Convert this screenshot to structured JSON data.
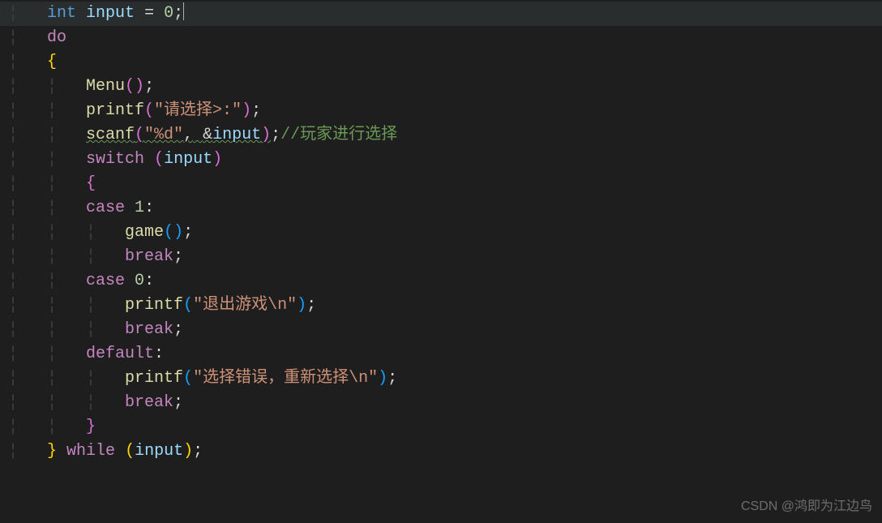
{
  "code": {
    "l1_kw_int": "int",
    "l1_var": "input",
    "l1_eq": "=",
    "l1_num": "0",
    "l1_semi": ";",
    "l2_do": "do",
    "l3_brace": "{",
    "l4_menu": "Menu",
    "l4_paren_o": "(",
    "l4_paren_c": ")",
    "l4_semi": ";",
    "l5_printf": "printf",
    "l5_paren_o": "(",
    "l5_str": "\"请选择>:\"",
    "l5_paren_c": ")",
    "l5_semi": ";",
    "l6_scanf": "scanf",
    "l6_paren_o": "(",
    "l6_str": "\"%d\"",
    "l6_comma": ",",
    "l6_amp": "&",
    "l6_var": "input",
    "l6_paren_c": ")",
    "l6_semi": ";",
    "l6_comment": "//玩家进行选择",
    "l7_switch": "switch",
    "l7_paren_o": "(",
    "l7_var": "input",
    "l7_paren_c": ")",
    "l8_brace": "{",
    "l9_case": "case",
    "l9_num": "1",
    "l9_colon": ":",
    "l10_game": "game",
    "l10_paren_o": "(",
    "l10_paren_c": ")",
    "l10_semi": ";",
    "l11_break": "break",
    "l11_semi": ";",
    "l12_case": "case",
    "l12_num": "0",
    "l12_colon": ":",
    "l13_printf": "printf",
    "l13_paren_o": "(",
    "l13_str": "\"退出游戏\\n\"",
    "l13_paren_c": ")",
    "l13_semi": ";",
    "l14_break": "break",
    "l14_semi": ";",
    "l15_default": "default",
    "l15_colon": ":",
    "l16_printf": "printf",
    "l16_paren_o": "(",
    "l16_str": "\"选择错误，重新选择\\n\"",
    "l16_paren_c": ")",
    "l16_semi": ";",
    "l17_break": "break",
    "l17_semi": ";",
    "l18_brace": "}",
    "l19_brace_c": "}",
    "l19_while": "while",
    "l19_paren_o": "(",
    "l19_var": "input",
    "l19_paren_c": ")",
    "l19_semi": ";"
  },
  "watermark": "CSDN @鸿即为江边鸟"
}
